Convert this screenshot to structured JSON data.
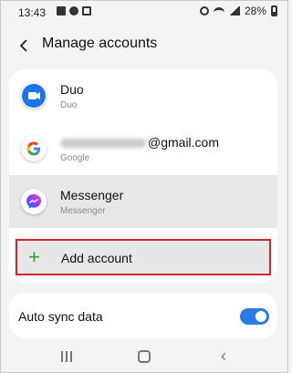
{
  "status_bar": {
    "time": "13:43",
    "battery": "28%"
  },
  "header": {
    "title": "Manage accounts"
  },
  "accounts": [
    {
      "name": "Duo",
      "type": "Duo",
      "icon": "duo-icon"
    },
    {
      "name": "@gmail.com",
      "type": "Google",
      "icon": "google-icon"
    },
    {
      "name": "Messenger",
      "type": "Messenger",
      "icon": "messenger-icon"
    }
  ],
  "add_account": {
    "label": "Add account",
    "icon": "plus-icon",
    "highlight_color": "#d5242b"
  },
  "auto_sync": {
    "label": "Auto sync data",
    "enabled": true,
    "accent": "#2b7de1"
  },
  "nav": {
    "recents_icon": "recents-icon",
    "home_icon": "home-icon",
    "back_icon": "back-icon"
  }
}
